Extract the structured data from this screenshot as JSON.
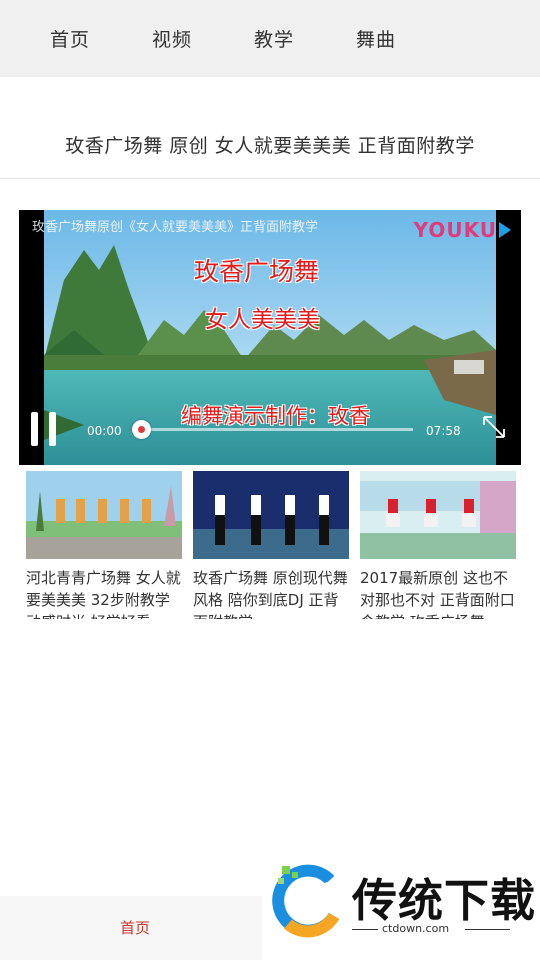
{
  "top_nav": {
    "tabs": [
      {
        "label": "首页"
      },
      {
        "label": "视频"
      },
      {
        "label": "教学"
      },
      {
        "label": "舞曲"
      }
    ]
  },
  "video": {
    "title": "玫香广场舞 原创 女人就要美美美 正背面附教学",
    "player_caption": "玫香广场舞原创《女人就要美美美》正背面附教学",
    "logo_text": "YOUKU",
    "overlay": {
      "line1": "玫香广场舞",
      "line2": "女人美美美",
      "line3": "编舞演示制作：玫香"
    },
    "current_time": "00:00",
    "total_time": "07:58",
    "progress": 0.0
  },
  "related": [
    {
      "caption": "河北青青广场舞 女人就要美美美 32步附教学 动感时尚 好学好看"
    },
    {
      "caption": "玫香广场舞 原创现代舞风格 陪你到底DJ 正背面附教学"
    },
    {
      "caption": "2017最新原创 这也不对那也不对 正背面附口令教学 玫香广场舞"
    }
  ],
  "bottom_bar": {
    "home_label": "首页"
  },
  "watermark": {
    "brand": "传统下载",
    "url": "ctdown.com"
  },
  "colors": {
    "accent": "#c8372d",
    "overlay_red": "#e21b1b",
    "youku_pink": "#e23a7a",
    "youku_blue": "#1ba0e8"
  }
}
